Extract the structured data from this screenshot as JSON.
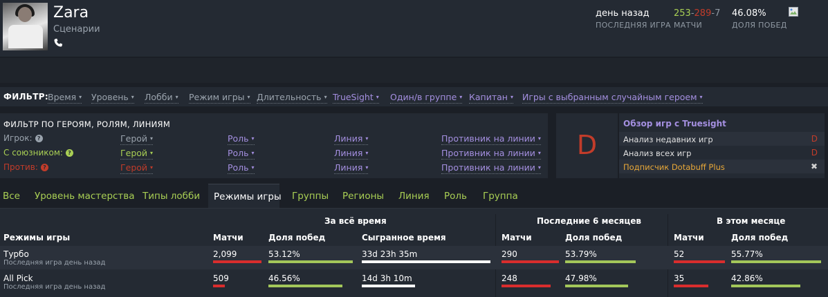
{
  "player": {
    "name": "Zara",
    "subtitle": "Сценарии"
  },
  "header_stats": {
    "last_match_value": "день назад",
    "last_match_label": "ПОСЛЕДНЯЯ ИГРА",
    "wins": "253",
    "losses": "289",
    "abandons": "7",
    "sep": "-",
    "matches_label": "МАТЧИ",
    "winrate_value": "46.08%",
    "winrate_label": "ДОЛЯ ПОБЕД"
  },
  "filter": {
    "label": "ФИЛЬТР:",
    "items": [
      "Время",
      "Уровень",
      "Лобби",
      "Режим игры",
      "Длительность",
      "TrueSight",
      "Один/в группе",
      "Капитан",
      "Игры с выбранным случайным героем"
    ]
  },
  "hero_filter": {
    "title": "ФИЛЬТР ПО ГЕРОЯМ, РОЛЯМ, ЛИНИЯМ",
    "rows": [
      {
        "label": "Игрок:",
        "hero": "Герой",
        "role": "Роль",
        "lane": "Линия",
        "opponent": "Противник на линии"
      },
      {
        "label": "С союзником:",
        "hero": "Герой",
        "role": "Роль",
        "lane": "Линия",
        "opponent": "Противник на линии"
      },
      {
        "label": "Против:",
        "hero": "Герой",
        "role": "Роль",
        "lane": "Линия",
        "opponent": "Противник на линии"
      }
    ],
    "question_glyph": "?",
    "caret_glyph": "▾"
  },
  "truesight": {
    "grade": "D",
    "title": "Обзор игр с Truesight",
    "rows": [
      {
        "text": "Анализ недавних игр",
        "grade": "D"
      },
      {
        "text": "Анализ всех игр",
        "grade": "D"
      },
      {
        "text": "Подписчик Dotabuff Plus",
        "grade": "✖"
      }
    ]
  },
  "tabs": [
    "Все",
    "Уровень мастерства",
    "Типы лобби",
    "Режимы игры",
    "Группы",
    "Регионы",
    "Линия",
    "Роль",
    "Группа"
  ],
  "active_tab": "Режимы игры",
  "table": {
    "group_all": "За всё время",
    "group_6m": "Последние 6 месяцев",
    "group_month": "В этом месяце",
    "col_mode": "Режимы игры",
    "col_matches": "Матчи",
    "col_winrate": "Доля побед",
    "col_time": "Сыгранное время",
    "rows": [
      {
        "mode": "Турбо",
        "sub": "Последняя игра день назад",
        "all_matches": "2,099",
        "all_matches_frac": 1.0,
        "all_winrate": "53.12%",
        "all_winrate_frac": 1.0,
        "all_time": "33d 23h 35m",
        "all_time_frac": 1.0,
        "m6_matches": "290",
        "m6_matches_frac": 1.0,
        "m6_winrate": "53.79%",
        "m6_winrate_frac": 1.0,
        "mo_matches": "52",
        "mo_matches_frac": 1.0,
        "mo_winrate": "55.77%",
        "mo_winrate_frac": 1.0
      },
      {
        "mode": "All Pick",
        "sub": "Последняя игра день назад",
        "all_matches": "509",
        "all_matches_frac": 0.24,
        "all_winrate": "46.56%",
        "all_winrate_frac": 0.877,
        "all_time": "14d 3h 10m",
        "all_time_frac": 0.415,
        "m6_matches": "248",
        "m6_matches_frac": 0.855,
        "m6_winrate": "47.98%",
        "m6_winrate_frac": 0.892,
        "mo_matches": "35",
        "mo_matches_frac": 0.673,
        "mo_winrate": "42.86%",
        "mo_winrate_frac": 0.769
      }
    ]
  },
  "colors": {
    "win": "#a9cf54",
    "loss": "#c23c2a",
    "truesight": "#a48fe0",
    "plus": "#e8a838"
  }
}
